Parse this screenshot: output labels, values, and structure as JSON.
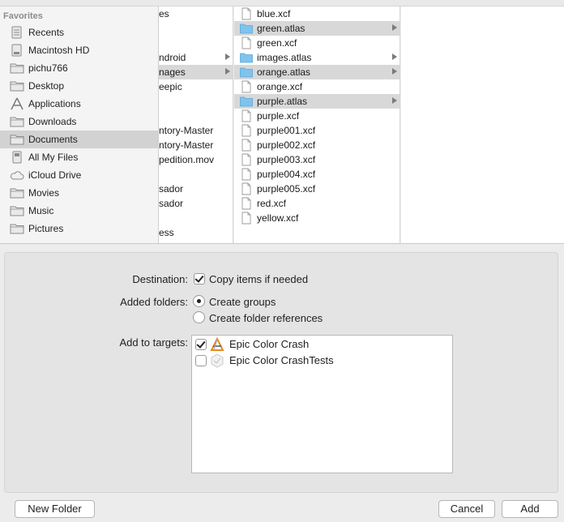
{
  "sidebar": {
    "header": "Favorites",
    "items": [
      {
        "label": "Recents",
        "icon": "recents-icon",
        "selected": false
      },
      {
        "label": "Macintosh HD",
        "icon": "hard-drive-icon",
        "selected": false
      },
      {
        "label": "pichu766",
        "icon": "folder-icon",
        "selected": false
      },
      {
        "label": "Desktop",
        "icon": "folder-icon",
        "selected": false
      },
      {
        "label": "Applications",
        "icon": "applications-icon",
        "selected": false
      },
      {
        "label": "Downloads",
        "icon": "folder-icon",
        "selected": false
      },
      {
        "label": "Documents",
        "icon": "folder-icon",
        "selected": true
      },
      {
        "label": "All My Files",
        "icon": "all-files-icon",
        "selected": false
      },
      {
        "label": "iCloud Drive",
        "icon": "cloud-icon",
        "selected": false
      },
      {
        "label": "Movies",
        "icon": "folder-icon",
        "selected": false
      },
      {
        "label": "Music",
        "icon": "folder-icon",
        "selected": false
      },
      {
        "label": "Pictures",
        "icon": "folder-icon",
        "selected": false
      }
    ]
  },
  "column1": {
    "items": [
      {
        "label": "es",
        "row": 0,
        "arrow": false,
        "highlight": false
      },
      {
        "label": "ndroid",
        "row": 3,
        "arrow": true,
        "highlight": false
      },
      {
        "label": "nages",
        "row": 4,
        "arrow": true,
        "highlight": true
      },
      {
        "label": "eepic",
        "row": 5,
        "arrow": false,
        "highlight": false
      },
      {
        "label": "ntory-Master",
        "row": 8,
        "arrow": false,
        "highlight": false
      },
      {
        "label": "ntory-Master",
        "row": 9,
        "arrow": false,
        "highlight": false
      },
      {
        "label": "pedition.mov",
        "row": 10,
        "arrow": false,
        "highlight": false
      },
      {
        "label": "sador",
        "row": 12,
        "arrow": false,
        "highlight": false
      },
      {
        "label": "sador",
        "row": 13,
        "arrow": false,
        "highlight": false
      },
      {
        "label": "ess",
        "row": 15,
        "arrow": false,
        "highlight": false
      }
    ]
  },
  "column2": {
    "items": [
      {
        "label": "blue.xcf",
        "kind": "file",
        "highlight": false
      },
      {
        "label": "green.atlas",
        "kind": "folder",
        "highlight": true
      },
      {
        "label": "green.xcf",
        "kind": "file",
        "highlight": false
      },
      {
        "label": "images.atlas",
        "kind": "folder",
        "highlight": false
      },
      {
        "label": "orange.atlas",
        "kind": "folder",
        "highlight": true
      },
      {
        "label": "orange.xcf",
        "kind": "file",
        "highlight": false
      },
      {
        "label": "purple.atlas",
        "kind": "folder",
        "highlight": true
      },
      {
        "label": "purple.xcf",
        "kind": "file",
        "highlight": false
      },
      {
        "label": "purple001.xcf",
        "kind": "file",
        "highlight": false
      },
      {
        "label": "purple002.xcf",
        "kind": "file",
        "highlight": false
      },
      {
        "label": "purple003.xcf",
        "kind": "file",
        "highlight": false
      },
      {
        "label": "purple004.xcf",
        "kind": "file",
        "highlight": false
      },
      {
        "label": "purple005.xcf",
        "kind": "file",
        "highlight": false
      },
      {
        "label": "red.xcf",
        "kind": "file",
        "highlight": false
      },
      {
        "label": "yellow.xcf",
        "kind": "file",
        "highlight": false
      }
    ]
  },
  "options": {
    "destination_label": "Destination:",
    "copy_items_label": "Copy items if needed",
    "copy_items_checked": true,
    "added_folders_label": "Added folders:",
    "create_groups_label": "Create groups",
    "create_groups_selected": true,
    "create_refs_label": "Create folder references",
    "create_refs_selected": false,
    "add_targets_label": "Add to targets:",
    "targets": [
      {
        "label": "Epic Color Crash",
        "checked": true,
        "icon": "app-target-icon"
      },
      {
        "label": "Epic Color CrashTests",
        "checked": false,
        "icon": "test-target-icon"
      }
    ]
  },
  "buttons": {
    "new_folder": "New Folder",
    "cancel": "Cancel",
    "add": "Add"
  },
  "colors": {
    "folder_blue": "#7fc3ee",
    "selection_gray": "#d2d2d2"
  }
}
